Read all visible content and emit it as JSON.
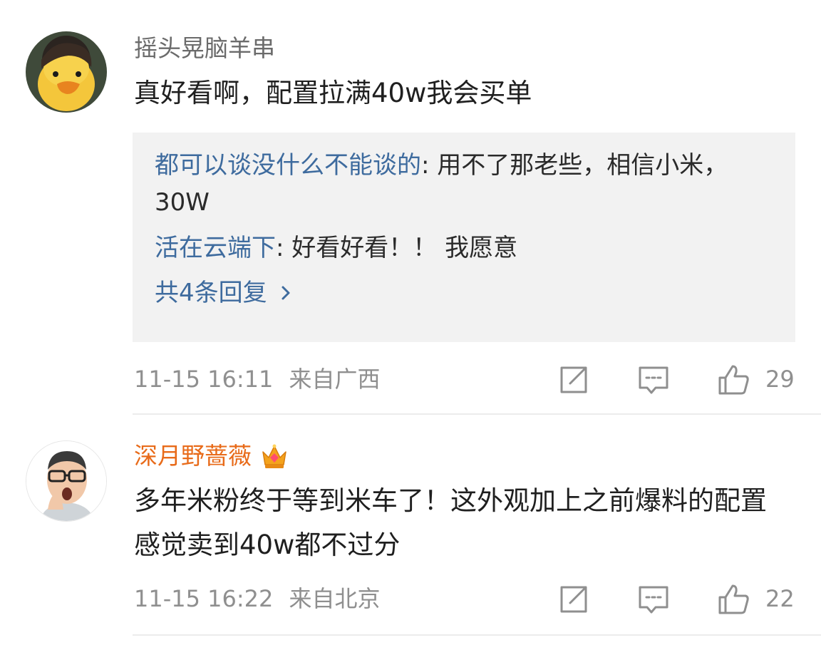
{
  "comments": [
    {
      "username": "摇头晃脑羊串",
      "content": "真好看啊，配置拉满40w我会买单",
      "replies": [
        {
          "name": "都可以谈没什么不能谈的",
          "separator": ": ",
          "text": "用不了那老些，相信小米，30W"
        },
        {
          "name": "活在云端下",
          "separator": ": ",
          "text": "好看好看！！ 我愿意"
        }
      ],
      "more_replies": "共4条回复",
      "time": "11-15 16:11",
      "location": "来自广西",
      "likes": "29"
    },
    {
      "username": "深月野蔷薇",
      "badge_icon": "crown-icon",
      "content": "多年米粉终于等到米车了！这外观加上之前爆料的配置感觉卖到40w都不过分",
      "time": "11-15 16:22",
      "location": "来自北京",
      "likes": "22"
    }
  ],
  "colors": {
    "link": "#3e6b9e",
    "vip_name": "#e86b1a",
    "meta": "#8f8f8f",
    "reply_bg": "#f2f2f2"
  }
}
